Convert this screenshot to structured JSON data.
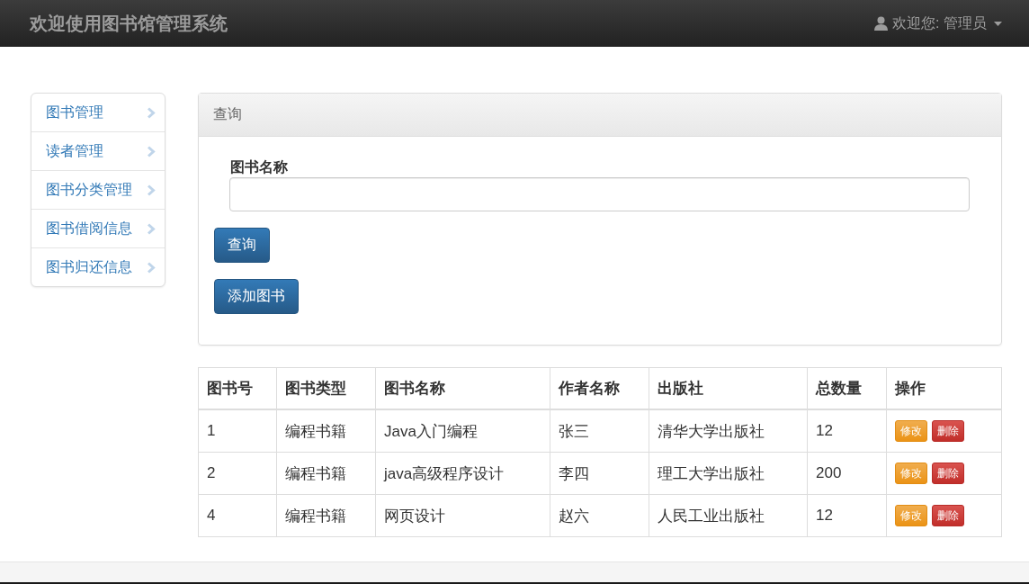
{
  "navbar": {
    "brand": "欢迎使用图书馆管理系统",
    "user": "欢迎您: 管理员"
  },
  "sidebar": {
    "items": [
      {
        "label": "图书管理"
      },
      {
        "label": "读者管理"
      },
      {
        "label": "图书分类管理"
      },
      {
        "label": "图书借阅信息"
      },
      {
        "label": "图书归还信息"
      }
    ]
  },
  "query_panel": {
    "heading": "查询",
    "field_label": "图书名称",
    "search_button": "查询",
    "add_button": "添加图书"
  },
  "table": {
    "columns": [
      "图书号",
      "图书类型",
      "图书名称",
      "作者名称",
      "出版社",
      "总数量",
      "操作"
    ],
    "rows": [
      {
        "cells": [
          "1",
          "编程书籍",
          "Java入门编程",
          "张三",
          "清华大学出版社",
          "12"
        ],
        "actions": [
          {
            "kind": "edit",
            "label": "修改"
          },
          {
            "kind": "delete",
            "label": "删除"
          }
        ]
      },
      {
        "cells": [
          "2",
          "编程书籍",
          "java高级程序设计",
          "李四",
          "理工大学出版社",
          "200"
        ],
        "actions": [
          {
            "kind": "edit",
            "label": "修改"
          },
          {
            "kind": "delete",
            "label": "删除"
          }
        ]
      },
      {
        "cells": [
          "4",
          "编程书籍",
          "网页设计",
          "赵六",
          "人民工业出版社",
          "12"
        ],
        "actions": [
          {
            "kind": "edit",
            "label": "修改"
          },
          {
            "kind": "delete",
            "label": "删除"
          }
        ]
      }
    ]
  }
}
